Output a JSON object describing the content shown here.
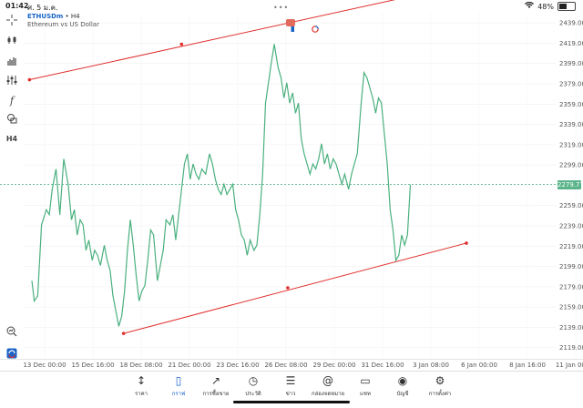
{
  "status_bar": {
    "time": "01:42",
    "date": "ศ. 5 ม.ค.",
    "dots": "•••",
    "battery_percent": 48,
    "battery_label": "48%"
  },
  "toolbar_icons": [
    "crosshair-icon",
    "indicator-icon",
    "bar-chart-icon",
    "settings-sliders-icon",
    "function-icon",
    "shapes-icon",
    "timeframe-label",
    "zoom-icon",
    "logo-icon"
  ],
  "toolbar": {
    "timeframe_label": "H4"
  },
  "chart_header": {
    "symbol": "ETHUSDm",
    "separator": " • ",
    "timeframe": "H4",
    "description": "Ethereum vs US Dollar"
  },
  "current_price_label": "2279.77",
  "colors": {
    "line": "#4ab07e",
    "trend": "#e0302d",
    "current_price": "#5ab38a",
    "accent": "#1a64c8"
  },
  "chart_data": {
    "type": "line",
    "symbol": "ETHUSDm",
    "y_ticks": [
      "2439.00",
      "2419.00",
      "2399.00",
      "2379.00",
      "2359.00",
      "2339.00",
      "2319.00",
      "2299.00",
      "2259.00",
      "2239.00",
      "2219.00",
      "2199.00",
      "2179.00",
      "2159.00",
      "2139.00",
      "2119.00"
    ],
    "ylim": [
      2108,
      2449
    ],
    "x_ticks": [
      "13 Dec 00:00",
      "15 Dec 16:00",
      "18 Dec 08:00",
      "21 Dec 00:00",
      "23 Dec 16:00",
      "26 Dec 08:00",
      "29 Dec 00:00",
      "31 Dec 16:00",
      "3 Jan 08:00",
      "6 Jan 00:00",
      "8 Jan 16:00",
      "11 Jan 00:00"
    ],
    "x_unit": "index on the x tick scale, 0 = 13 Dec 00:00, 1 = 15 Dec 16:00, ...",
    "series": [
      {
        "values": [
          [
            0.0,
            2185
          ],
          [
            0.05,
            2165
          ],
          [
            0.12,
            2170
          ],
          [
            0.2,
            2240
          ],
          [
            0.3,
            2255
          ],
          [
            0.36,
            2250
          ],
          [
            0.42,
            2275
          ],
          [
            0.5,
            2295
          ],
          [
            0.58,
            2250
          ],
          [
            0.66,
            2305
          ],
          [
            0.75,
            2280
          ],
          [
            0.82,
            2245
          ],
          [
            0.88,
            2255
          ],
          [
            0.94,
            2230
          ],
          [
            1.0,
            2245
          ],
          [
            1.06,
            2240
          ],
          [
            1.12,
            2215
          ],
          [
            1.18,
            2225
          ],
          [
            1.25,
            2205
          ],
          [
            1.3,
            2215
          ],
          [
            1.36,
            2210
          ],
          [
            1.42,
            2200
          ],
          [
            1.5,
            2220
          ],
          [
            1.56,
            2205
          ],
          [
            1.62,
            2195
          ],
          [
            1.68,
            2170
          ],
          [
            1.74,
            2155
          ],
          [
            1.8,
            2140
          ],
          [
            1.86,
            2150
          ],
          [
            1.92,
            2175
          ],
          [
            1.98,
            2215
          ],
          [
            2.04,
            2245
          ],
          [
            2.1,
            2220
          ],
          [
            2.16,
            2190
          ],
          [
            2.22,
            2165
          ],
          [
            2.28,
            2175
          ],
          [
            2.34,
            2180
          ],
          [
            2.4,
            2205
          ],
          [
            2.46,
            2235
          ],
          [
            2.52,
            2230
          ],
          [
            2.6,
            2185
          ],
          [
            2.66,
            2200
          ],
          [
            2.72,
            2215
          ],
          [
            2.78,
            2245
          ],
          [
            2.86,
            2240
          ],
          [
            2.92,
            2250
          ],
          [
            2.98,
            2225
          ],
          [
            3.04,
            2250
          ],
          [
            3.1,
            2275
          ],
          [
            3.16,
            2300
          ],
          [
            3.22,
            2310
          ],
          [
            3.28,
            2285
          ],
          [
            3.34,
            2300
          ],
          [
            3.4,
            2290
          ],
          [
            3.46,
            2285
          ],
          [
            3.52,
            2295
          ],
          [
            3.6,
            2290
          ],
          [
            3.68,
            2310
          ],
          [
            3.74,
            2300
          ],
          [
            3.8,
            2285
          ],
          [
            3.86,
            2275
          ],
          [
            3.92,
            2270
          ],
          [
            3.98,
            2280
          ],
          [
            4.04,
            2270
          ],
          [
            4.1,
            2275
          ],
          [
            4.16,
            2280
          ],
          [
            4.22,
            2255
          ],
          [
            4.28,
            2245
          ],
          [
            4.34,
            2230
          ],
          [
            4.4,
            2225
          ],
          [
            4.46,
            2210
          ],
          [
            4.52,
            2225
          ],
          [
            4.6,
            2215
          ],
          [
            4.66,
            2220
          ],
          [
            4.72,
            2250
          ],
          [
            4.78,
            2290
          ],
          [
            4.84,
            2360
          ],
          [
            4.9,
            2380
          ],
          [
            4.96,
            2400
          ],
          [
            5.02,
            2418
          ],
          [
            5.1,
            2395
          ],
          [
            5.16,
            2385
          ],
          [
            5.22,
            2365
          ],
          [
            5.28,
            2380
          ],
          [
            5.34,
            2360
          ],
          [
            5.4,
            2370
          ],
          [
            5.46,
            2350
          ],
          [
            5.52,
            2360
          ],
          [
            5.58,
            2325
          ],
          [
            5.64,
            2310
          ],
          [
            5.7,
            2300
          ],
          [
            5.76,
            2290
          ],
          [
            5.82,
            2300
          ],
          [
            5.88,
            2295
          ],
          [
            5.94,
            2305
          ],
          [
            6.0,
            2320
          ],
          [
            6.06,
            2300
          ],
          [
            6.12,
            2310
          ],
          [
            6.18,
            2295
          ],
          [
            6.24,
            2305
          ],
          [
            6.3,
            2300
          ],
          [
            6.36,
            2290
          ],
          [
            6.42,
            2280
          ],
          [
            6.48,
            2290
          ],
          [
            6.56,
            2275
          ],
          [
            6.62,
            2290
          ],
          [
            6.68,
            2300
          ],
          [
            6.74,
            2310
          ],
          [
            6.82,
            2360
          ],
          [
            6.88,
            2390
          ],
          [
            6.94,
            2385
          ],
          [
            7.0,
            2375
          ],
          [
            7.06,
            2365
          ],
          [
            7.12,
            2350
          ],
          [
            7.18,
            2365
          ],
          [
            7.24,
            2360
          ],
          [
            7.3,
            2330
          ],
          [
            7.36,
            2300
          ],
          [
            7.42,
            2255
          ],
          [
            7.48,
            2235
          ],
          [
            7.54,
            2205
          ],
          [
            7.6,
            2210
          ],
          [
            7.66,
            2230
          ],
          [
            7.72,
            2220
          ],
          [
            7.78,
            2230
          ],
          [
            7.84,
            2279.77
          ]
        ]
      }
    ],
    "trend_lines": [
      {
        "from": [
          -0.05,
          2383
        ],
        "to": [
          8.2,
          2469
        ]
      },
      {
        "from": [
          1.9,
          2133
        ],
        "to": [
          9.0,
          2222
        ]
      }
    ],
    "trend_points": [
      [
        -0.05,
        2383
      ],
      [
        3.1,
        2418
      ],
      [
        8.2,
        2469
      ],
      [
        1.9,
        2133
      ],
      [
        5.3,
        2178
      ],
      [
        9.0,
        2222
      ]
    ],
    "current_price": 2279.77,
    "current_price_line": "dotted"
  },
  "bottom_nav": [
    {
      "icon": "↕",
      "name": "quotes",
      "label": "ราคา"
    },
    {
      "icon": "▯",
      "name": "chart",
      "label": "กราฟ",
      "active": true
    },
    {
      "icon": "↗",
      "name": "trade",
      "label": "การซื้อขาย"
    },
    {
      "icon": "◷",
      "name": "history",
      "label": "ประวัติ"
    },
    {
      "icon": "☰",
      "name": "news",
      "label": "ข่าว"
    },
    {
      "icon": "@",
      "name": "mailbox",
      "label": "กล่องจดหมาย"
    },
    {
      "icon": "▭",
      "name": "chat",
      "label": "แชท"
    },
    {
      "icon": "◉",
      "name": "account",
      "label": "บัญชี"
    },
    {
      "icon": "⚙",
      "name": "settings",
      "label": "การตั้งค่า"
    }
  ]
}
